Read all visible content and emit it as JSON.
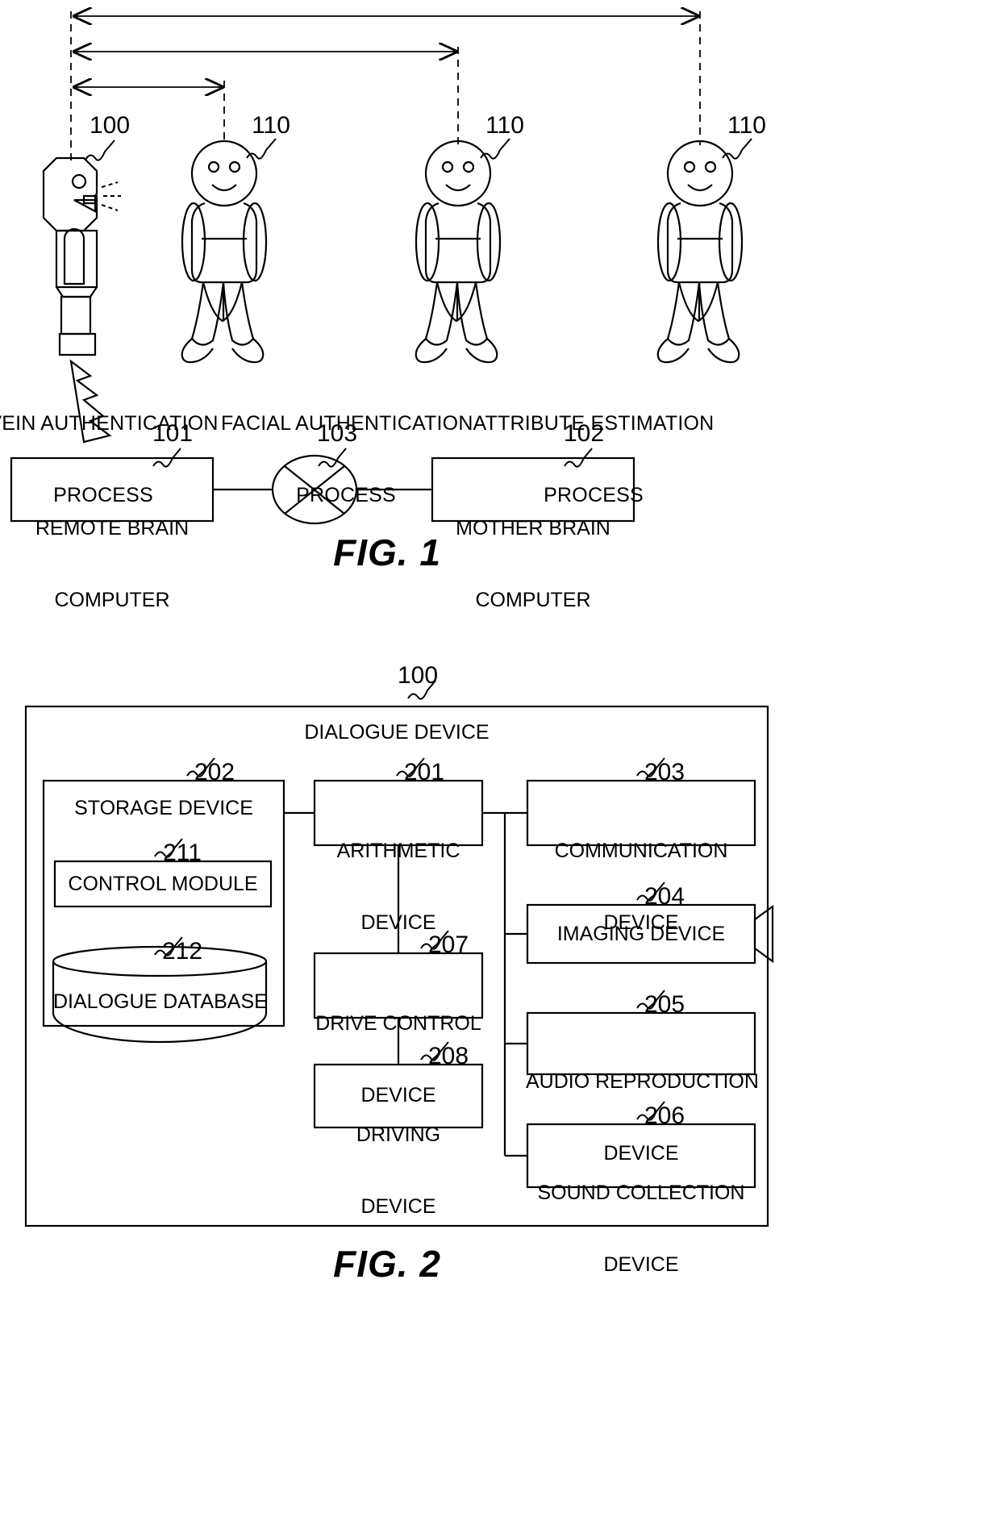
{
  "figure1": {
    "caption": "FIG. 1",
    "robot_ref": "100",
    "person_refs": [
      "110",
      "110",
      "110"
    ],
    "process_labels": [
      {
        "line1": "VEIN AUTHENTICATION",
        "line2": "PROCESS"
      },
      {
        "line1": "FACIAL AUTHENTICATION",
        "line2": "PROCESS"
      },
      {
        "line1": "ATTRIBUTE ESTIMATION",
        "line2": "PROCESS"
      }
    ],
    "boxes": [
      {
        "ref": "101",
        "line1": "REMOTE BRAIN",
        "line2": "COMPUTER"
      },
      {
        "ref": "102",
        "line1": "MOTHER BRAIN",
        "line2": "COMPUTER"
      }
    ],
    "network_ref": "103",
    "network_icon": "network-cloud-icon",
    "robot_icons": {
      "eye": "robot-eye-icon",
      "speech": "speech-lines-icon",
      "wireless": "wireless-bolt-icon"
    },
    "range_arrows": 3
  },
  "figure2": {
    "caption": "FIG. 2",
    "outer_ref": "100",
    "outer_title": "DIALOGUE DEVICE",
    "blocks": [
      {
        "ref": "202",
        "line1": "STORAGE DEVICE",
        "line2": ""
      },
      {
        "ref": "211",
        "line1": "CONTROL MODULE",
        "line2": ""
      },
      {
        "ref": "212",
        "line1": "DIALOGUE DATABASE",
        "line2": ""
      },
      {
        "ref": "201",
        "line1": "ARITHMETIC",
        "line2": "DEVICE"
      },
      {
        "ref": "203",
        "line1": "COMMUNICATION",
        "line2": "DEVICE"
      },
      {
        "ref": "204",
        "line1": "IMAGING DEVICE",
        "line2": ""
      },
      {
        "ref": "205",
        "line1": "AUDIO REPRODUCTION",
        "line2": "DEVICE"
      },
      {
        "ref": "206",
        "line1": "SOUND COLLECTION",
        "line2": "DEVICE"
      },
      {
        "ref": "207",
        "line1": "DRIVE CONTROL",
        "line2": "DEVICE"
      },
      {
        "ref": "208",
        "line1": "DRIVING",
        "line2": "DEVICE"
      }
    ],
    "icons": {
      "database": "cylinder-database-icon",
      "camera": "camera-lens-icon"
    }
  }
}
